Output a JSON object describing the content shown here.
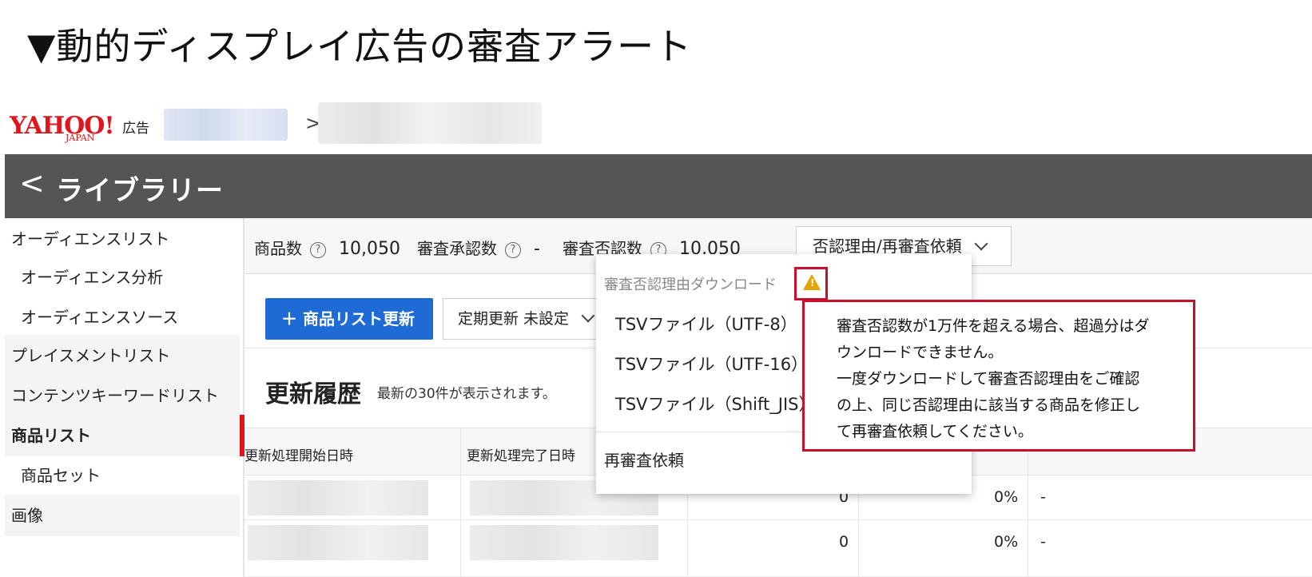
{
  "heading": "▼動的ディスプレイ広告の審査アラート",
  "header": {
    "logo_text": "YAHOO!",
    "logo_sub": "JAPAN",
    "logo_ad": "広告",
    "breadcrumb_sep": ">"
  },
  "library": {
    "back": "<",
    "title": "ライブラリー"
  },
  "sidebar": {
    "items": [
      {
        "label": "オーディエンスリスト"
      },
      {
        "label": "オーディエンス分析"
      },
      {
        "label": "オーディエンスソース"
      },
      {
        "label": "プレイスメントリスト"
      },
      {
        "label": "コンテンツキーワードリスト"
      },
      {
        "label": "商品リスト"
      },
      {
        "label": "商品セット"
      },
      {
        "label": "画像"
      }
    ]
  },
  "stats": {
    "products_label": "商品数",
    "products_value": "10,050",
    "approved_label": "審査承認数",
    "approved_value": "-",
    "rejected_label": "審査否認数",
    "rejected_value": "10,050",
    "dropdown_label": "否認理由/再審査依頼",
    "help_glyph": "?"
  },
  "toolbar": {
    "update_label": "＋ 商品リスト更新",
    "schedule_label": "定期更新 未設定"
  },
  "history": {
    "title": "更新履歴",
    "subtitle": "最新の30件が表示されます。"
  },
  "table": {
    "headers": [
      "更新処理開始日時",
      "更新処理完了日時"
    ],
    "rows": [
      {
        "c1": "0",
        "c2": "0%",
        "c3": "-"
      },
      {
        "c1": "0",
        "c2": "0%",
        "c3": "-"
      }
    ]
  },
  "menu": {
    "header": "審査否認理由ダウンロード",
    "items": [
      "TSVファイル（UTF-8）",
      "TSVファイル（UTF-16）",
      "TSVファイル（Shift_JIS）"
    ],
    "footer": "再審査依頼"
  },
  "tooltip": {
    "lines": [
      "審査否認数が1万件を超える場合、超過分はダ",
      "ウンロードできません。",
      "一度ダウンロードして審査否認理由をご確認",
      "の上、同じ否認理由に該当する商品を修正し",
      "て再審査依頼してください。"
    ]
  },
  "colors": {
    "accent": "#1f6bd6",
    "alert": "#c8102e",
    "warning": "#e6a300",
    "header_bg": "#555555"
  }
}
